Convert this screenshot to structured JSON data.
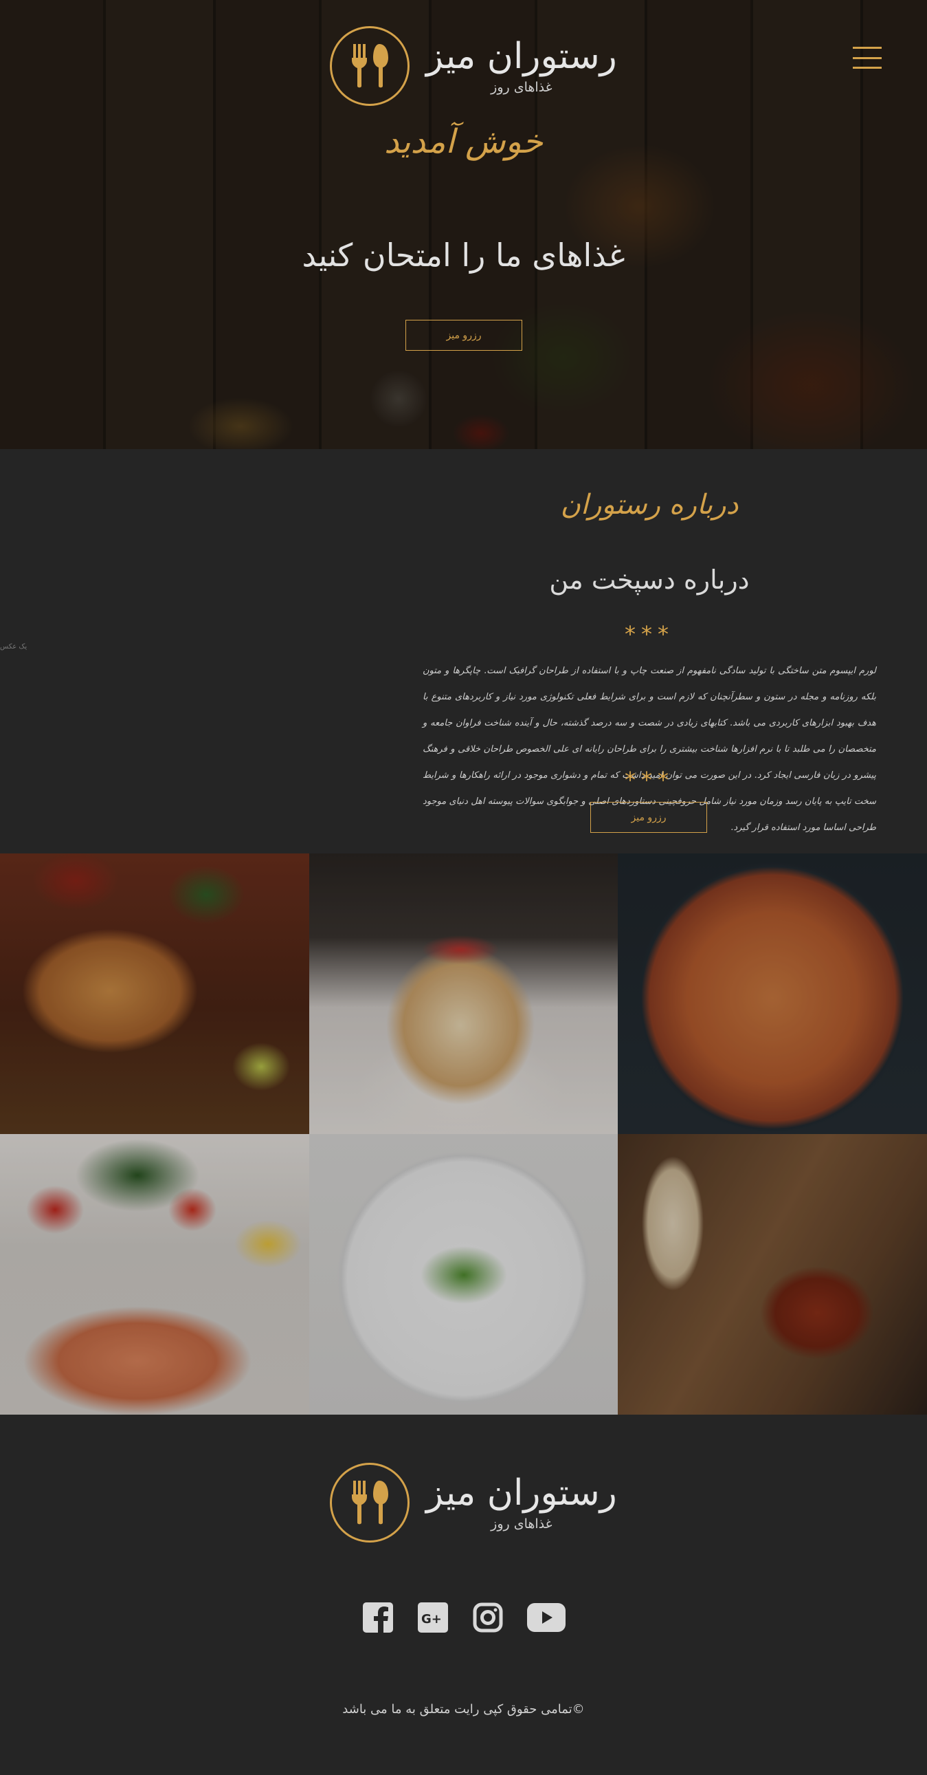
{
  "brand": {
    "name": "رستوران میز",
    "tagline": "غذاهای روز",
    "accent_color": "#d4a24a",
    "emblem_icon": "fork-spoon-icon"
  },
  "hero": {
    "welcome": "خوش آمدید",
    "title": "غذاهای ما را امتحان کنید",
    "button_label": "رزرو میز",
    "menu_icon": "hamburger-menu-icon"
  },
  "about": {
    "subtitle": "درباره رستوران",
    "title": "درباره دسپخت من",
    "stars": "***",
    "paragraph": "لورم ایپسوم متن ساختگی با تولید سادگی نامفهوم از صنعت چاپ و با استفاده از طراحان گرافیک است. چاپگرها و متون بلکه روزنامه و مجله در ستون و سطرآنچنان که لازم است و برای شرایط فعلی تکنولوژی مورد نیاز و کاربردهای متنوع با هدف بهبود ابزارهای کاربردی می باشد. کتابهای زیادی در شصت و سه درصد گذشته، حال و آینده شناخت فراوان جامعه و متخصصان را می طلبد تا با نرم افزارها شناخت بیشتری را برای طراحان رایانه ای علی الخصوص طراحان خلاقی و فرهنگ پیشرو در زبان فارسی ایجاد کرد. در این صورت می توان امید داشت که تمام و دشواری موجود در ارائه راهکارها و شرایط سخت تایپ به پایان رسد وزمان مورد نیاز شامل حروفچینی دستاوردهای اصلی و جوابگوی سوالات پیوسته اهل دنیای موجود طراحی اساسا مورد استفاده قرار گیرد.",
    "button_label": "رزرو میز",
    "side_note": "یک عکس"
  },
  "gallery": [
    {
      "name": "burrito"
    },
    {
      "name": "pancakes"
    },
    {
      "name": "pizza"
    },
    {
      "name": "salmon-salad"
    },
    {
      "name": "avocado-toast"
    },
    {
      "name": "grilled-fish"
    }
  ],
  "footer": {
    "socials": [
      {
        "icon": "facebook-icon"
      },
      {
        "icon": "google-plus-icon"
      },
      {
        "icon": "instagram-icon"
      },
      {
        "icon": "youtube-icon"
      }
    ],
    "copyright": "©تمامی حقوق کپی رایت متعلق به ما می باشد"
  }
}
